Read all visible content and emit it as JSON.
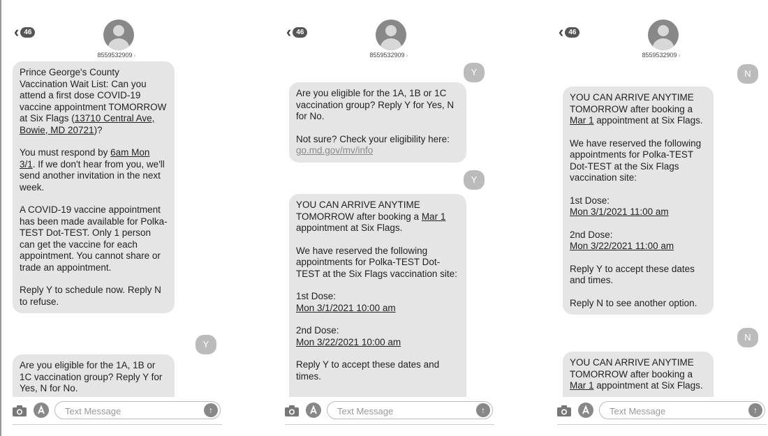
{
  "phones": [
    {
      "header": {
        "back_badge": "46",
        "contact": "8559532909"
      },
      "messages": [
        {
          "type": "received",
          "paragraphs": [
            [
              "Prince George's County Vaccination Wait List: Can you attend a first dose COVID-19 vaccine appointment TOMORROW at Six Flags (",
              "13710 Central Ave, Bowie, MD 20721",
              ")?"
            ],
            [
              "You must respond by ",
              "6am Mon 3/1",
              ".  If we don't hear from you, we'll send another invitation in the next week."
            ],
            [
              "A COVID-19 vaccine appointment has been made available for Polka-TEST Dot-TEST. Only 1 person can get the vaccine for each appointment. You cannot share or trade an appointment."
            ],
            [
              "Reply Y to schedule now. Reply N to refuse."
            ]
          ]
        },
        {
          "type": "sent",
          "text": "Y"
        },
        {
          "type": "received",
          "paragraphs": [
            [
              "Are you eligible for the 1A, 1B or 1C vaccination group? Reply Y for Yes, N for No."
            ]
          ]
        }
      ],
      "input": {
        "placeholder": "Text Message"
      }
    },
    {
      "header": {
        "back_badge": "46",
        "contact": "8559532909"
      },
      "messages": [
        {
          "type": "sent",
          "text": "Y"
        },
        {
          "type": "received",
          "paragraphs": [
            [
              "Are you eligible for the 1A, 1B or 1C vaccination group? Reply Y for Yes, N for No."
            ],
            [
              "Not sure?  Check your eligibility here: ",
              "go.md.gov/mv/info"
            ]
          ]
        },
        {
          "type": "sent",
          "text": "Y"
        },
        {
          "type": "received",
          "paragraphs": [
            [
              "YOU CAN ARRIVE ANYTIME TOMORROW after booking a ",
              "Mar 1",
              " appointment at Six Flags."
            ],
            [
              "We have reserved the following appointments for Polka-TEST Dot-TEST at the Six Flags vaccination site:"
            ],
            [
              "1st Dose:",
              "Mon 3/1/2021 10:00 am"
            ],
            [
              "2nd Dose:",
              "Mon 3/22/2021 10:00 am"
            ],
            [
              "Reply Y to accept these dates and times."
            ]
          ]
        }
      ],
      "input": {
        "placeholder": "Text Message"
      }
    },
    {
      "header": {
        "back_badge": "46",
        "contact": "8559532909"
      },
      "messages": [
        {
          "type": "sent",
          "text": "N"
        },
        {
          "type": "received",
          "paragraphs": [
            [
              "YOU CAN ARRIVE ANYTIME TOMORROW after booking a ",
              "Mar 1",
              " appointment at Six Flags."
            ],
            [
              "We have reserved the following appointments for Polka-TEST Dot-TEST at the Six Flags vaccination site:"
            ],
            [
              "1st Dose:",
              "Mon 3/1/2021 11:00 am"
            ],
            [
              "2nd Dose:",
              "Mon 3/22/2021 11:00 am"
            ],
            [
              "Reply Y to accept these dates and times."
            ],
            [
              "Reply N to see another option."
            ]
          ]
        },
        {
          "type": "sent",
          "text": "N"
        },
        {
          "type": "received",
          "paragraphs": [
            [
              "YOU CAN ARRIVE ANYTIME TOMORROW after booking a ",
              "Mar 1",
              " appointment at Six Flags."
            ]
          ]
        }
      ],
      "input": {
        "placeholder": "Text Message"
      }
    }
  ]
}
